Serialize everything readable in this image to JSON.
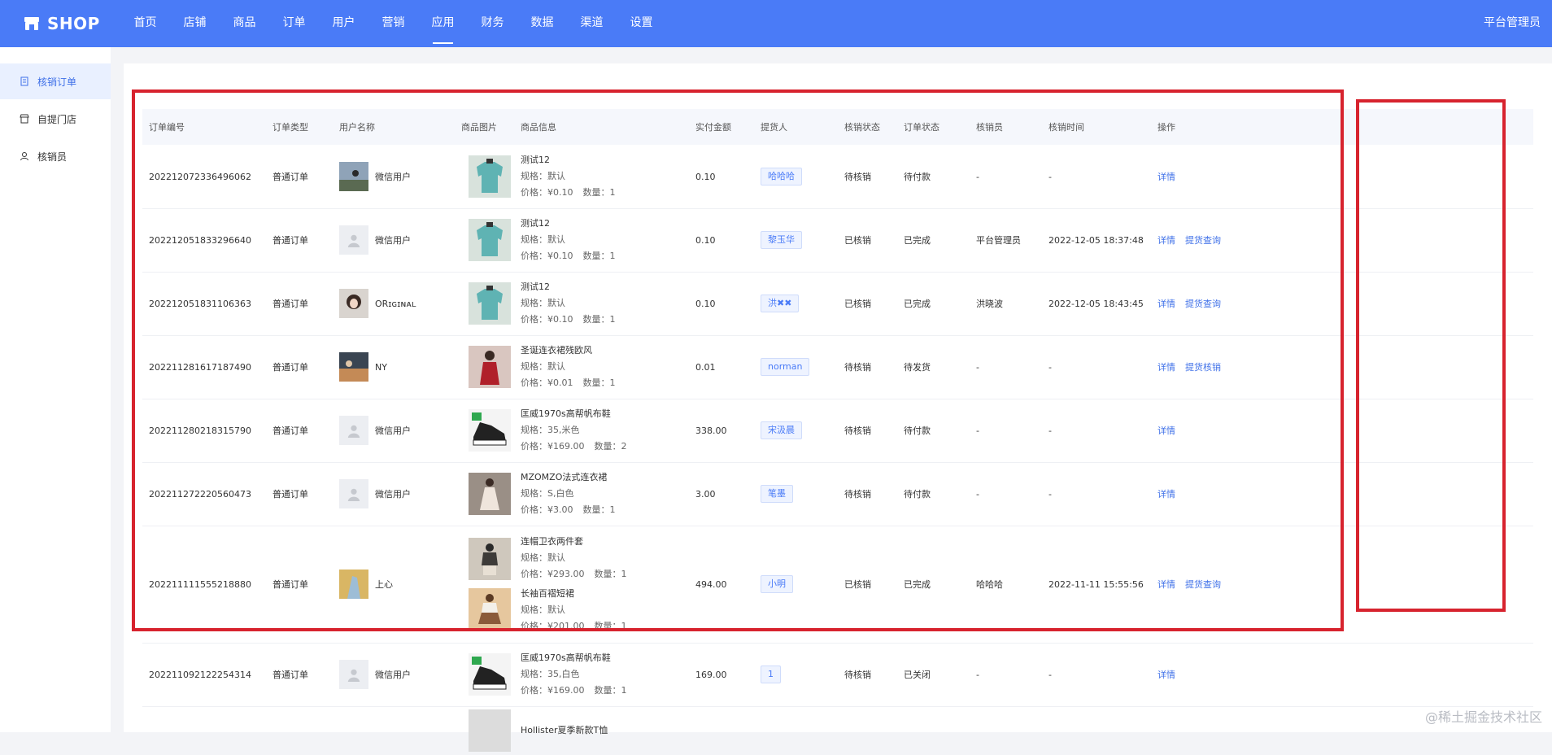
{
  "brand": {
    "name": "SHOP"
  },
  "nav": [
    "首页",
    "店铺",
    "商品",
    "订单",
    "用户",
    "营销",
    "应用",
    "财务",
    "数据",
    "渠道",
    "设置"
  ],
  "nav_active": "应用",
  "user": "平台管理员",
  "sidebar": [
    {
      "label": "核销订单",
      "icon": "order-doc-icon",
      "active": true
    },
    {
      "label": "自提门店",
      "icon": "store-icon",
      "active": false
    },
    {
      "label": "核销员",
      "icon": "user-icon",
      "active": false
    }
  ],
  "table": {
    "headers": {
      "order_no": "订单编号",
      "type": "订单类型",
      "user": "用户名称",
      "img": "商品图片",
      "info": "商品信息",
      "amount": "实付金额",
      "picker": "提货人",
      "verify_status": "核销状态",
      "order_status": "订单状态",
      "verifier": "核销员",
      "verify_time": "核销时间",
      "actions": "操作"
    },
    "rows": [
      {
        "order_no": "202212072336496062",
        "type": "普通订单",
        "user": "微信用户",
        "products": [
          {
            "name": "测试12",
            "spec": "规格：默认",
            "price": "价格：¥0.10",
            "qty": "数量：1"
          }
        ],
        "amount": "0.10",
        "picker": "哈哈哈",
        "verify_status": "待核销",
        "order_status": "待付款",
        "verifier": "-",
        "verify_time": "-",
        "actions": [
          "详情"
        ]
      },
      {
        "order_no": "202212051833296640",
        "type": "普通订单",
        "user": "微信用户",
        "products": [
          {
            "name": "测试12",
            "spec": "规格：默认",
            "price": "价格：¥0.10",
            "qty": "数量：1"
          }
        ],
        "amount": "0.10",
        "picker": "黎玉华",
        "verify_status": "已核销",
        "order_status": "已完成",
        "verifier": "平台管理员",
        "verify_time": "2022-12-05 18:37:48",
        "actions": [
          "详情",
          "提货查询"
        ]
      },
      {
        "order_no": "202212051831106363",
        "type": "普通订单",
        "user": "ORɪɢɪɴᴀʟ",
        "products": [
          {
            "name": "测试12",
            "spec": "规格：默认",
            "price": "价格：¥0.10",
            "qty": "数量：1"
          }
        ],
        "amount": "0.10",
        "picker": "洪✖✖",
        "verify_status": "已核销",
        "order_status": "已完成",
        "verifier": "洪晓波",
        "verify_time": "2022-12-05 18:43:45",
        "actions": [
          "详情",
          "提货查询"
        ]
      },
      {
        "order_no": "202211281617187490",
        "type": "普通订单",
        "user": "NY",
        "products": [
          {
            "name": "圣诞连衣裙残欧风",
            "spec": "规格：默认",
            "price": "价格：¥0.01",
            "qty": "数量：1"
          }
        ],
        "amount": "0.01",
        "picker": "norman",
        "verify_status": "待核销",
        "order_status": "待发货",
        "verifier": "-",
        "verify_time": "-",
        "actions": [
          "详情",
          "提货核销"
        ]
      },
      {
        "order_no": "202211280218315790",
        "type": "普通订单",
        "user": "微信用户",
        "products": [
          {
            "name": "匡威1970s高帮帆布鞋",
            "spec": "规格：35,米色",
            "price": "价格：¥169.00",
            "qty": "数量：2"
          }
        ],
        "amount": "338.00",
        "picker": "宋汲晨",
        "verify_status": "待核销",
        "order_status": "待付款",
        "verifier": "-",
        "verify_time": "-",
        "actions": [
          "详情"
        ]
      },
      {
        "order_no": "202211272220560473",
        "type": "普通订单",
        "user": "微信用户",
        "products": [
          {
            "name": "MZOMZO法式连衣裙",
            "spec": "规格：S,白色",
            "price": "价格：¥3.00",
            "qty": "数量：1"
          }
        ],
        "amount": "3.00",
        "picker": "笔墨",
        "verify_status": "待核销",
        "order_status": "待付款",
        "verifier": "-",
        "verify_time": "-",
        "actions": [
          "详情"
        ]
      },
      {
        "order_no": "202211111555218880",
        "type": "普通订单",
        "user": "上心",
        "products": [
          {
            "name": "连帽卫衣两件套",
            "spec": "规格：默认",
            "price": "价格：¥293.00",
            "qty": "数量：1"
          },
          {
            "name": "长袖百褶短裙",
            "spec": "规格：默认",
            "price": "价格：¥201.00",
            "qty": "数量：1"
          }
        ],
        "amount": "494.00",
        "picker": "小明",
        "verify_status": "已核销",
        "order_status": "已完成",
        "verifier": "哈哈哈",
        "verify_time": "2022-11-11 15:55:56",
        "actions": [
          "详情",
          "提货查询"
        ]
      },
      {
        "order_no": "202211092122254314",
        "type": "普通订单",
        "user": "微信用户",
        "products": [
          {
            "name": "匡威1970s高帮帆布鞋",
            "spec": "规格：35,白色",
            "price": "价格：¥169.00",
            "qty": "数量：1"
          }
        ],
        "amount": "169.00",
        "picker": "1",
        "verify_status": "待核销",
        "order_status": "已关闭",
        "verifier": "-",
        "verify_time": "-",
        "actions": [
          "详情"
        ]
      },
      {
        "order_no": "",
        "type": "",
        "user": "",
        "products": [
          {
            "name": "Hollister夏季新款T恤",
            "spec": "",
            "price": "",
            "qty": ""
          }
        ],
        "amount": "",
        "picker": "",
        "verify_status": "",
        "order_status": "",
        "verifier": "",
        "verify_time": "",
        "actions": []
      }
    ]
  },
  "watermark": "@稀土掘金技术社区",
  "colors": {
    "primary": "#4a7bf7",
    "highlight_box": "#d7232e",
    "link": "#3f70e8"
  }
}
